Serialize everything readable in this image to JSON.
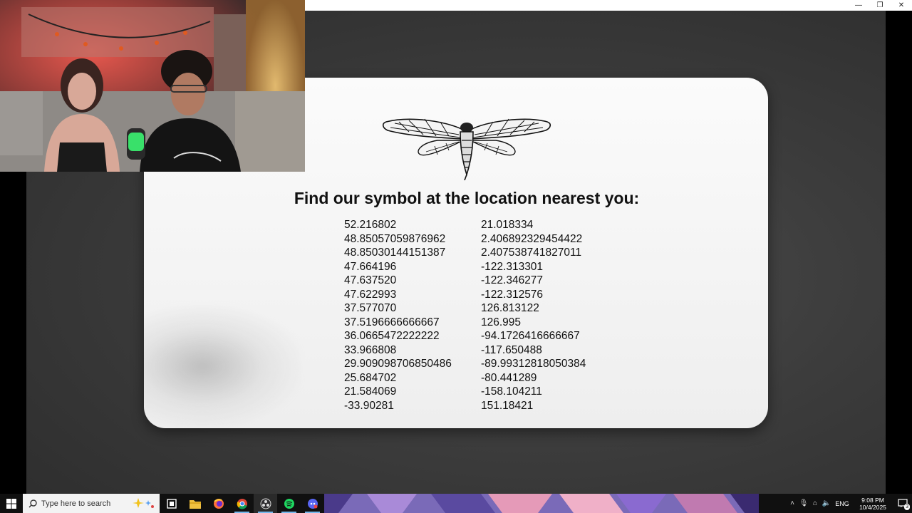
{
  "window": {
    "minimize_glyph": "—",
    "restore_glyph": "❐",
    "close_glyph": "✕"
  },
  "slide": {
    "headline": "Find our symbol at the location nearest you:",
    "coordinates": [
      {
        "lat": "52.216802",
        "lon": "21.018334"
      },
      {
        "lat": "48.85057059876962",
        "lon": "2.406892329454422"
      },
      {
        "lat": "48.85030144151387",
        "lon": "2.407538741827011"
      },
      {
        "lat": "47.664196",
        "lon": "-122.313301"
      },
      {
        "lat": "47.637520",
        "lon": "-122.346277"
      },
      {
        "lat": "47.622993",
        "lon": "-122.312576"
      },
      {
        "lat": "37.577070",
        "lon": "126.813122"
      },
      {
        "lat": "37.5196666666667",
        "lon": "126.995"
      },
      {
        "lat": "36.0665472222222",
        "lon": "-94.1726416666667"
      },
      {
        "lat": "33.966808",
        "lon": "-117.650488"
      },
      {
        "lat": "29.909098706850486",
        "lon": "-89.99312818050384"
      },
      {
        "lat": "25.684702",
        "lon": "-80.441289"
      },
      {
        "lat": "21.584069",
        "lon": "-158.104211"
      },
      {
        "lat": "-33.90281",
        "lon": "151.18421"
      }
    ]
  },
  "taskbar": {
    "search_placeholder": "Type here to search",
    "apps": [
      "task-view-icon",
      "file-explorer-icon",
      "firefox-icon",
      "chrome-icon",
      "obs-icon",
      "spotify-icon",
      "discord-icon"
    ],
    "language": "ENG",
    "time": "9:08 PM",
    "date": "10/4/2025",
    "notification_count": "3"
  },
  "colors": {
    "taskbar": "#101010",
    "card": "#f2f2f2",
    "stage": "#3c3c3c",
    "accent": "#76b9ed"
  }
}
